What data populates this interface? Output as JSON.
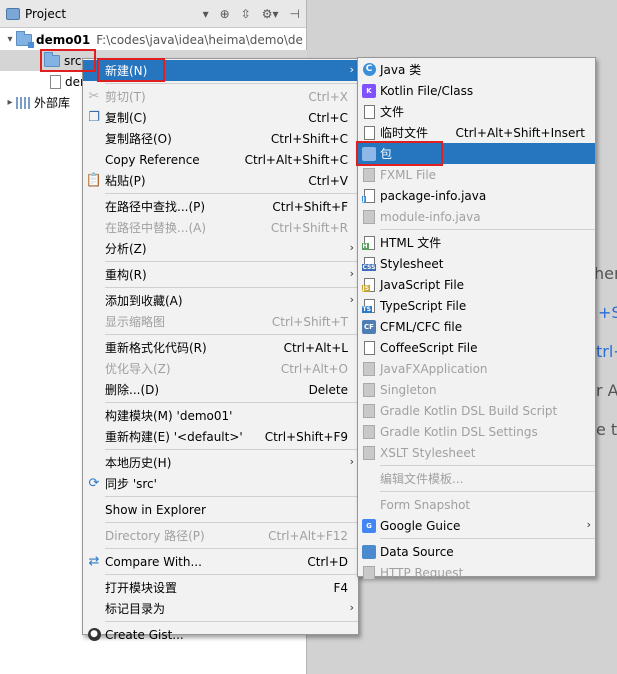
{
  "project_panel": {
    "title": "Project",
    "header_icons": [
      "chevron-down-icon",
      "target-icon",
      "collapse-icon",
      "gear-icon",
      "pin-icon"
    ],
    "tree": {
      "root_name": "demo01",
      "root_path": "F:\\codes\\java\\idea\\heima\\demo\\de",
      "src_label": "src",
      "demo_file_label": "den",
      "external_libs_label": "外部库"
    }
  },
  "editor": {
    "partial_texts": [
      "her",
      "+SI",
      "trl+",
      "r A",
      "e to"
    ]
  },
  "context_menu": {
    "items": [
      {
        "label": "新建(N)",
        "shortcut": "",
        "icon": "",
        "selected": true,
        "submenu": true
      },
      {
        "sep": true
      },
      {
        "label": "剪切(T)",
        "shortcut": "Ctrl+X",
        "icon": "scissors-icon",
        "disabled": true
      },
      {
        "label": "复制(C)",
        "shortcut": "Ctrl+C",
        "icon": "copy-icon"
      },
      {
        "label": "复制路径(O)",
        "shortcut": "Ctrl+Shift+C",
        "icon": ""
      },
      {
        "label": "Copy Reference",
        "shortcut": "Ctrl+Alt+Shift+C",
        "icon": ""
      },
      {
        "label": "粘贴(P)",
        "shortcut": "Ctrl+V",
        "icon": "paste-icon"
      },
      {
        "sep": true
      },
      {
        "label": "在路径中查找...(P)",
        "shortcut": "Ctrl+Shift+F",
        "icon": ""
      },
      {
        "label": "在路径中替换...(A)",
        "shortcut": "Ctrl+Shift+R",
        "icon": "",
        "disabled": true
      },
      {
        "label": "分析(Z)",
        "shortcut": "",
        "icon": "",
        "submenu": true
      },
      {
        "sep": true
      },
      {
        "label": "重构(R)",
        "shortcut": "",
        "icon": "",
        "submenu": true
      },
      {
        "sep": true
      },
      {
        "label": "添加到收藏(A)",
        "shortcut": "",
        "icon": "",
        "submenu": true
      },
      {
        "label": "显示缩略图",
        "shortcut": "Ctrl+Shift+T",
        "icon": "",
        "disabled": true
      },
      {
        "sep": true
      },
      {
        "label": "重新格式化代码(R)",
        "shortcut": "Ctrl+Alt+L",
        "icon": ""
      },
      {
        "label": "优化导入(Z)",
        "shortcut": "Ctrl+Alt+O",
        "icon": "",
        "disabled": true
      },
      {
        "label": "删除...(D)",
        "shortcut": "Delete",
        "icon": ""
      },
      {
        "sep": true
      },
      {
        "label": "构建模块(M) 'demo01'",
        "shortcut": "",
        "icon": ""
      },
      {
        "label": "重新构建(E) '<default>'",
        "shortcut": "Ctrl+Shift+F9",
        "icon": ""
      },
      {
        "sep": true
      },
      {
        "label": "本地历史(H)",
        "shortcut": "",
        "icon": "",
        "submenu": true
      },
      {
        "label": "同步 'src'",
        "shortcut": "",
        "icon": "sync-icon"
      },
      {
        "sep": true
      },
      {
        "label": "Show in Explorer",
        "shortcut": "",
        "icon": ""
      },
      {
        "sep": true
      },
      {
        "label": "Directory 路径(P)",
        "shortcut": "Ctrl+Alt+F12",
        "icon": "",
        "disabled": true
      },
      {
        "sep": true
      },
      {
        "label": "Compare With...",
        "shortcut": "Ctrl+D",
        "icon": "compare-icon"
      },
      {
        "sep": true
      },
      {
        "label": "打开模块设置",
        "shortcut": "F4",
        "icon": ""
      },
      {
        "label": "标记目录为",
        "shortcut": "",
        "icon": "",
        "submenu": true
      },
      {
        "sep": true
      },
      {
        "label": "Create Gist...",
        "shortcut": "",
        "icon": "github-icon"
      }
    ]
  },
  "new_submenu": {
    "items": [
      {
        "label": "Java 类",
        "shortcut": "",
        "icon": "java-class-icon"
      },
      {
        "label": "Kotlin File/Class",
        "shortcut": "",
        "icon": "kotlin-icon"
      },
      {
        "label": "文件",
        "shortcut": "",
        "icon": "file-icon"
      },
      {
        "label": "临时文件",
        "shortcut": "Ctrl+Alt+Shift+Insert",
        "icon": "scratch-file-icon"
      },
      {
        "label": "包",
        "shortcut": "",
        "icon": "package-icon",
        "selected": true
      },
      {
        "label": "FXML File",
        "shortcut": "",
        "icon": "fxml-icon",
        "disabled": true
      },
      {
        "label": "package-info.java",
        "shortcut": "",
        "icon": "package-info-icon"
      },
      {
        "label": "module-info.java",
        "shortcut": "",
        "icon": "module-info-icon",
        "disabled": true
      },
      {
        "sep": true
      },
      {
        "label": "HTML 文件",
        "shortcut": "",
        "icon": "html-icon"
      },
      {
        "label": "Stylesheet",
        "shortcut": "",
        "icon": "css-icon"
      },
      {
        "label": "JavaScript File",
        "shortcut": "",
        "icon": "js-icon"
      },
      {
        "label": "TypeScript File",
        "shortcut": "",
        "icon": "ts-icon"
      },
      {
        "label": "CFML/CFC file",
        "shortcut": "",
        "icon": "cf-icon"
      },
      {
        "label": "CoffeeScript File",
        "shortcut": "",
        "icon": "coffee-icon"
      },
      {
        "label": "JavaFXApplication",
        "shortcut": "",
        "icon": "javafx-icon",
        "disabled": true
      },
      {
        "label": "Singleton",
        "shortcut": "",
        "icon": "singleton-icon",
        "disabled": true
      },
      {
        "label": "Gradle Kotlin DSL Build Script",
        "shortcut": "",
        "icon": "gradle-icon",
        "disabled": true
      },
      {
        "label": "Gradle Kotlin DSL Settings",
        "shortcut": "",
        "icon": "gradle-icon",
        "disabled": true
      },
      {
        "label": "XSLT Stylesheet",
        "shortcut": "",
        "icon": "xslt-icon",
        "disabled": true
      },
      {
        "sep": true
      },
      {
        "label": "编辑文件模板...",
        "shortcut": "",
        "icon": "",
        "disabled": true
      },
      {
        "sep": true
      },
      {
        "label": "Form Snapshot",
        "shortcut": "",
        "icon": "",
        "disabled": true
      },
      {
        "label": "Google Guice",
        "shortcut": "",
        "icon": "guice-icon",
        "submenu": true
      },
      {
        "sep": true
      },
      {
        "label": "Data Source",
        "shortcut": "",
        "icon": "database-icon"
      },
      {
        "label": "HTTP Request",
        "shortcut": "",
        "icon": "http-icon",
        "disabled": true
      }
    ]
  },
  "colors": {
    "selection": "#2675bf",
    "highlight_box": "#e02020",
    "menu_bg": "#f2f2f2",
    "disabled_text": "#a0a0a0"
  }
}
